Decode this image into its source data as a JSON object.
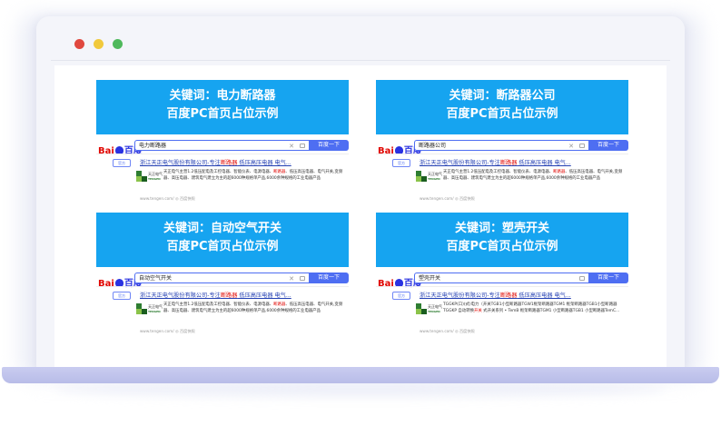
{
  "window": {
    "dots": [
      "red",
      "yellow",
      "green"
    ]
  },
  "panels": [
    {
      "banner_line1": "关键词：电力断路器",
      "banner_line2": "百度PC首页占位示例",
      "logo_bai": "Bai",
      "logo_du": "百度",
      "query": "电力断路器",
      "button": "百度一下",
      "tag": "官方",
      "result_title_a": "浙江天正电气股份有限公司-专注",
      "result_title_hl": "断路器",
      "result_title_b": " 低压高压电器 电气...",
      "brand": "天正电气",
      "brand_en": "TENGEN",
      "desc_a": "天正电气主营1.2低压配电及工控电器、智能仪表、电源电器、",
      "desc_hl": "断路器",
      "desc_b": "、低压高压电器、电气开关,变频器、高压电器、建筑电气建立为主的超6000种规格单产品,6000余种规格的工业电器产品",
      "url": "www.tengen.com/ ◎ 百度快照"
    },
    {
      "banner_line1": "关键词：断路器公司",
      "banner_line2": "百度PC首页占位示例",
      "logo_bai": "Bai",
      "logo_du": "百度",
      "query": "断路器公司",
      "button": "百度一下",
      "tag": "官方",
      "result_title_a": "浙江天正电气股份有限公司-专注",
      "result_title_hl": "断路器",
      "result_title_b": " 低压高压电器 电气...",
      "brand": "天正电气",
      "brand_en": "TENGEN",
      "desc_a": "天正电气主营1.2低压配电及工控电器、智能仪表、电源电器、",
      "desc_hl": "断路器",
      "desc_b": "、低压高压电器、电气开关,变频器、高压电器、建筑电气建立为主的超6000种规格单产品,6000余种规格的工业电器产品",
      "url": "www.tengen.com/ ◎ 百度快照"
    },
    {
      "banner_line1": "关键词：自动空气开关",
      "banner_line2": "百度PC首页占位示例",
      "logo_bai": "Bai",
      "logo_du": "百度",
      "query": "自动空气开关",
      "button": "百度一下",
      "tag": "官方",
      "result_title_a": "浙江天正电气股份有限公司-专注",
      "result_title_hl": "断路器",
      "result_title_b": " 低压高压电器 电气...",
      "brand": "天正电气",
      "brand_en": "TENGEN",
      "desc_a": "天正电气主营1.2低压配电及工控电器、智能仪表、电源电器、",
      "desc_hl": "断路器",
      "desc_b": "、低压高压电器、电气开关,变频器、高压电器、建筑电气建立为主的超6000种规格单产品,6000余种规格的工业电器产品",
      "url": "www.tengen.com/ ◎ 百度快照"
    },
    {
      "banner_line1": "关键词：塑壳开关",
      "banner_line2": "百度PC首页占位示例",
      "logo_bai": "Bai",
      "logo_du": "百度",
      "query": "塑壳开关",
      "button": "百度一下",
      "tag": "官方",
      "result_title_a": "浙江天正电气股份有限公司-专注",
      "result_title_hl": "断路器",
      "result_title_b": " 低压高压电器 电气...",
      "brand": "天正电气",
      "brand_en": "TENGEN",
      "desc_a": "TGGKP(口)(式)电力（开关TGB1小型断路器TGW1框架断路器TGM1 框架断路器TGB1小型断路器TGGKP 自动转换",
      "desc_hl": "开关",
      "desc_b": " 式开关系列 • TemB 框架断路器TGM1 小型断路器TGB1 小型断路器TemC...",
      "url": "www.tengen.com/ ◎ 百度快照"
    }
  ]
}
